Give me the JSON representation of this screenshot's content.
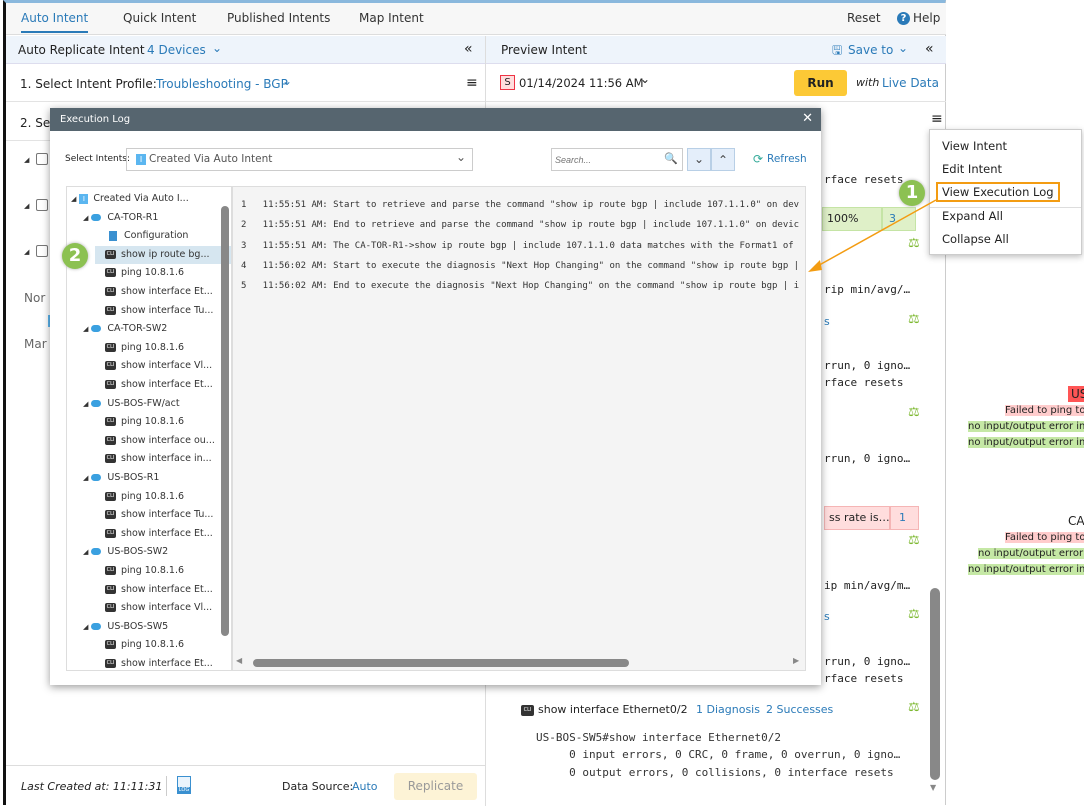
{
  "tabs": [
    "Auto Intent",
    "Quick Intent",
    "Published Intents",
    "Map Intent"
  ],
  "top_actions": {
    "reset": "Reset",
    "help": "Help"
  },
  "left": {
    "title": "Auto Replicate Intent",
    "devices": "4 Devices",
    "step1_label": "1. Select Intent Profile:",
    "step1_value": "Troubleshooting - BGP",
    "step2_label": "2. Sel",
    "tree_stubs": [
      "Nor",
      "Mar"
    ],
    "footer": {
      "last_created": "Last Created at: 11:11:31",
      "log_icon": "LOG",
      "data_source_label": "Data Source:",
      "data_source_value": "Auto",
      "replicate": "Replicate"
    }
  },
  "right": {
    "title": "Preview Intent",
    "save_to": "Save to",
    "badge": "S",
    "datetime": "01/14/2024 11:56 AM",
    "run": "Run",
    "with": "with",
    "live_data": "Live Data",
    "fragments": [
      "rface resets",
      "100%",
      "3",
      "rip min/avg/…",
      "s",
      "rrun, 0 igno…",
      "rface resets",
      "rrun, 0 igno…",
      "ss rate is…",
      "1",
      "ip min/avg/m…",
      "s",
      "rrun, 0 igno…",
      "rface resets"
    ],
    "cli_title": "show interface Ethernet0/2",
    "diagnosis": "1 Diagnosis",
    "successes": "2 Successes",
    "output": [
      "US-BOS-SW5#show interface Ethernet0/2",
      "     0 input errors, 0 CRC, 0 frame, 0 overrun, 0 igno…",
      "     0 output errors, 0 collisions, 0 interface resets"
    ]
  },
  "modal": {
    "title": "Execution Log",
    "select_label": "Select Intents:",
    "select_value": "Created Via Auto Intent",
    "search_placeholder": "Search...",
    "refresh": "Refresh",
    "tree": [
      {
        "level": 0,
        "type": "intent",
        "label": "Created Via Auto I..."
      },
      {
        "level": 1,
        "type": "device",
        "label": "CA-TOR-R1"
      },
      {
        "level": 2,
        "type": "config",
        "label": "Configuration"
      },
      {
        "level": 2,
        "type": "cli",
        "label": "show ip route bg...",
        "selected": true
      },
      {
        "level": 2,
        "type": "cli",
        "label": "ping 10.8.1.6"
      },
      {
        "level": 2,
        "type": "cli",
        "label": "show interface Et..."
      },
      {
        "level": 2,
        "type": "cli",
        "label": "show interface Tu..."
      },
      {
        "level": 1,
        "type": "device",
        "label": "CA-TOR-SW2"
      },
      {
        "level": 2,
        "type": "cli",
        "label": "ping 10.8.1.6"
      },
      {
        "level": 2,
        "type": "cli",
        "label": "show interface Vl..."
      },
      {
        "level": 2,
        "type": "cli",
        "label": "show interface Et..."
      },
      {
        "level": 1,
        "type": "device",
        "label": "US-BOS-FW/act"
      },
      {
        "level": 2,
        "type": "cli",
        "label": "ping 10.8.1.6"
      },
      {
        "level": 2,
        "type": "cli",
        "label": "show interface ou..."
      },
      {
        "level": 2,
        "type": "cli",
        "label": "show interface in..."
      },
      {
        "level": 1,
        "type": "device",
        "label": "US-BOS-R1"
      },
      {
        "level": 2,
        "type": "cli",
        "label": "ping 10.8.1.6"
      },
      {
        "level": 2,
        "type": "cli",
        "label": "show interface Tu..."
      },
      {
        "level": 2,
        "type": "cli",
        "label": "show interface Et..."
      },
      {
        "level": 1,
        "type": "device",
        "label": "US-BOS-SW2"
      },
      {
        "level": 2,
        "type": "cli",
        "label": "ping 10.8.1.6"
      },
      {
        "level": 2,
        "type": "cli",
        "label": "show interface Et..."
      },
      {
        "level": 2,
        "type": "cli",
        "label": "show interface Vl..."
      },
      {
        "level": 1,
        "type": "device",
        "label": "US-BOS-SW5"
      },
      {
        "level": 2,
        "type": "cli",
        "label": "ping 10.8.1.6"
      },
      {
        "level": 2,
        "type": "cli",
        "label": "show interface Et..."
      }
    ],
    "log": [
      "1   11:55:51 AM: Start to retrieve and parse the command \"show ip route bgp | include 107.1.1.0\" on dev",
      "2   11:55:51 AM: End to retrieve and parse the command \"show ip route bgp | include 107.1.1.0\" on devic",
      "3   11:55:51 AM: The CA-TOR-R1->show ip route bgp | include 107.1.1.0 data matches with the Format1 of",
      "4   11:56:02 AM: Start to execute the diagnosis \"Next Hop Changing\" on the command \"show ip route bgp |",
      "5   11:56:02 AM: End to execute the diagnosis \"Next Hop Changing\" on the command \"show ip route bgp | i"
    ]
  },
  "context_menu": [
    "View Intent",
    "Edit Intent",
    "View Execution Log",
    "Expand All",
    "Collapse All"
  ],
  "steps": [
    "1",
    "2"
  ],
  "background": {
    "labels": [
      "US",
      "CA"
    ],
    "failed": "Failed to ping to",
    "ok": "no input/output error in"
  },
  "colors": {
    "accent": "#2a7ab8",
    "run": "#fcc936",
    "header": "#56656f",
    "highlight": "#f39c12",
    "success": "#8cc152"
  }
}
